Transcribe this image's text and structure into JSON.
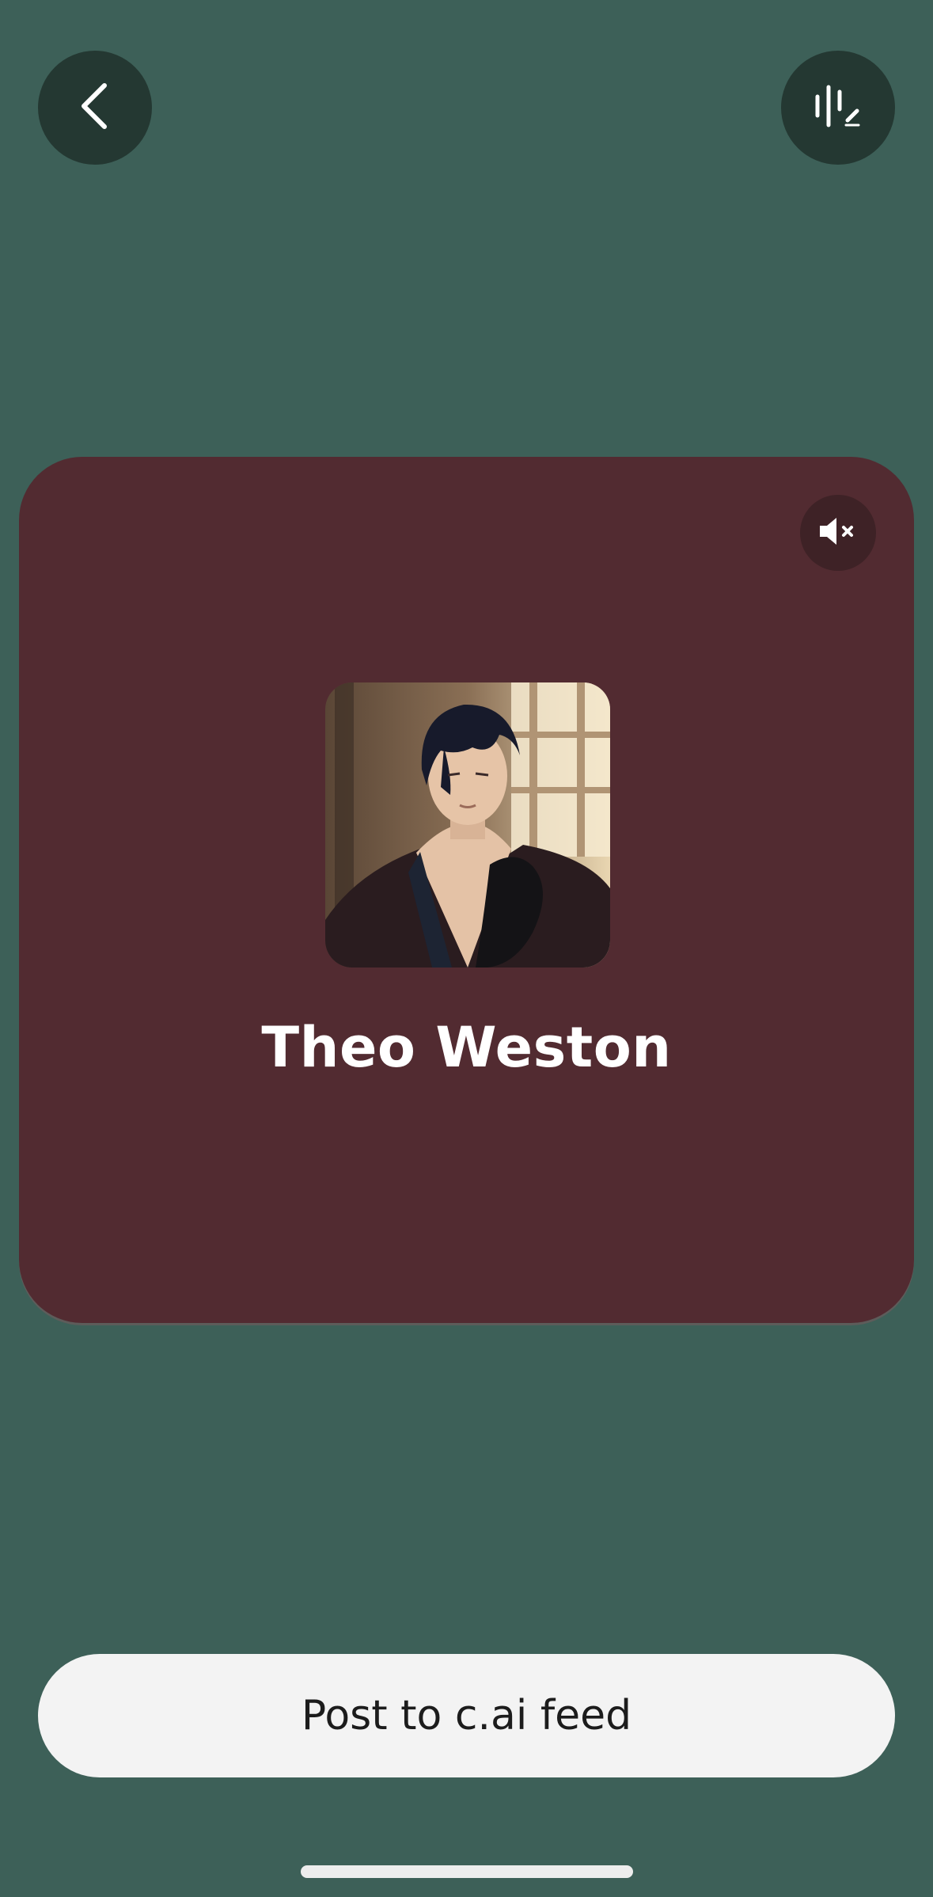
{
  "header": {
    "back_icon": "chevron-left-icon",
    "voice_icon": "voice-edit-icon"
  },
  "card": {
    "background_color": "#522b31",
    "mute_icon": "speaker-muted-icon",
    "avatar_description": "character-avatar-image",
    "character_name": "Theo Weston"
  },
  "footer": {
    "post_label": "Post to c.ai feed"
  },
  "colors": {
    "page_background": "#3d6058",
    "round_button": "#243832",
    "post_button": "#f3f3f3"
  }
}
